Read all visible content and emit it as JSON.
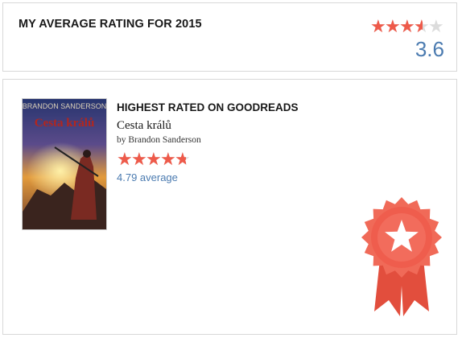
{
  "average_card": {
    "title": "MY AVERAGE RATING FOR 2015",
    "rating_value": "3.6",
    "rating_fraction": 0.72
  },
  "highest_card": {
    "label": "HIGHEST RATED ON GOODREADS",
    "book": {
      "title": "Cesta králů",
      "author_line": "by Brandon Sanderson",
      "average_text": "4.79 average",
      "rating_fraction": 0.958,
      "cover": {
        "author_text": "BRANDON SANDERSON",
        "title_text": "Cesta králů"
      }
    },
    "badge_icon": "award-ribbon-star-icon"
  },
  "colors": {
    "star_filled": "#ee5a4a",
    "star_empty": "#dcdcdc",
    "link_blue": "#4b7bb0",
    "ribbon_red": "#ee5a4a"
  }
}
